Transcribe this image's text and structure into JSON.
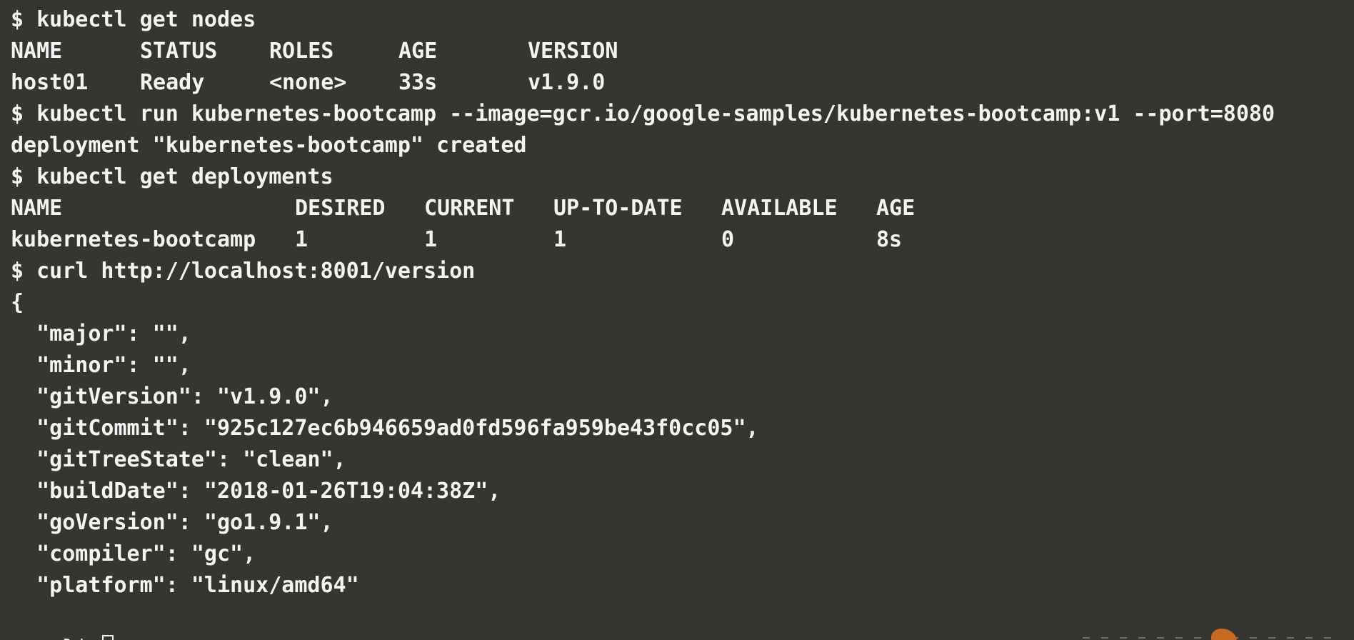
{
  "terminal": {
    "cmd1": "$ kubectl get nodes",
    "nodes_headers": [
      "NAME",
      "STATUS",
      "ROLES",
      "AGE",
      "VERSION"
    ],
    "nodes_row": [
      "host01",
      "Ready",
      "<none>",
      "33s",
      "v1.9.0"
    ],
    "cmd2": "$ kubectl run kubernetes-bootcamp --image=gcr.io/google-samples/kubernetes-bootcamp:v1 --port=8080",
    "out2": "deployment \"kubernetes-bootcamp\" created",
    "cmd3": "$ kubectl get deployments",
    "deploy_headers": [
      "NAME",
      "DESIRED",
      "CURRENT",
      "UP-TO-DATE",
      "AVAILABLE",
      "AGE"
    ],
    "deploy_row": [
      "kubernetes-bootcamp",
      "1",
      "1",
      "1",
      "0",
      "8s"
    ],
    "cmd4": "$ curl http://localhost:8001/version",
    "json_lines": [
      "{",
      "  \"major\": \"\",",
      "  \"minor\": \"\",",
      "  \"gitVersion\": \"v1.9.0\",",
      "  \"gitCommit\": \"925c127ec6b946659ad0fd596fa959be43f0cc05\",",
      "  \"gitTreeState\": \"clean\",",
      "  \"buildDate\": \"2018-01-26T19:04:38Z\",",
      "  \"goVersion\": \"go1.9.1\",",
      "  \"compiler\": \"gc\",",
      "  \"platform\": \"linux/amd64\""
    ],
    "prompt_last": "}$ ",
    "colors": {
      "background": "#353532",
      "foreground": "#f4f4f2"
    }
  }
}
